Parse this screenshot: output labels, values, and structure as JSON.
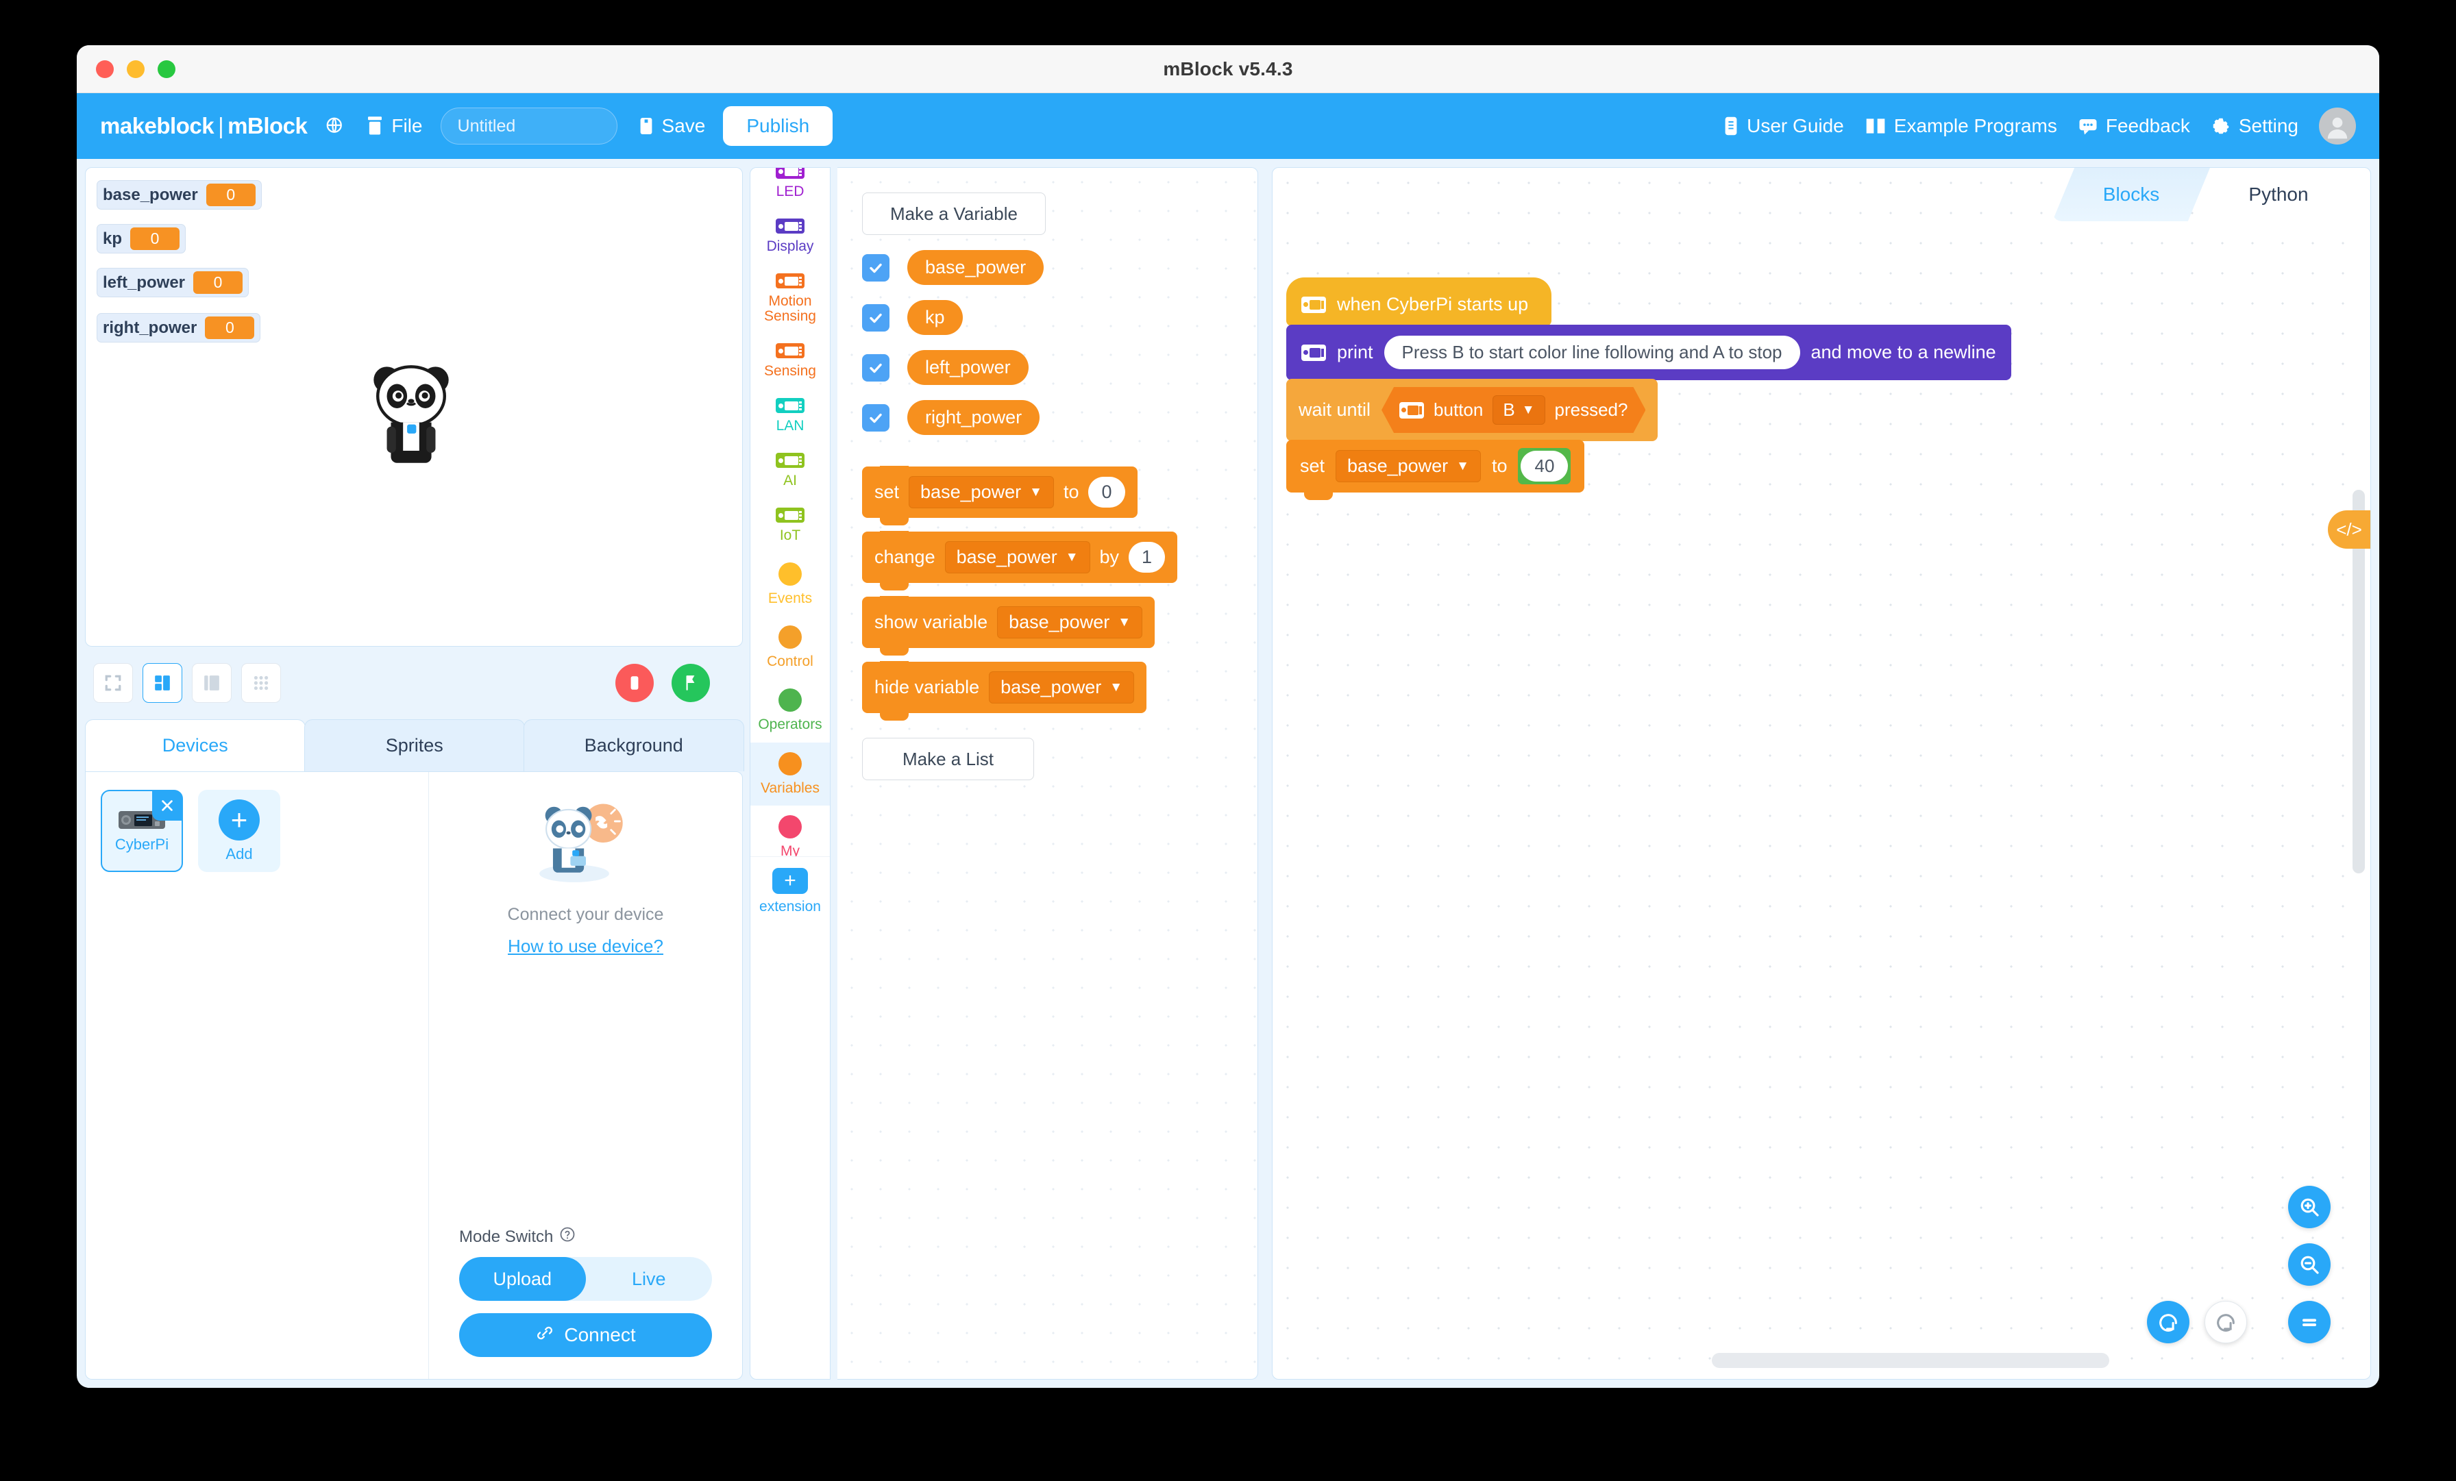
{
  "window": {
    "title": "mBlock v5.4.3",
    "traffic_lights": [
      "close",
      "minimize",
      "maximize"
    ]
  },
  "toolbar": {
    "logo_left": "makeblock",
    "logo_sep": "|",
    "logo_right": "mBlock",
    "globe_icon": "globe-icon",
    "file_icon": "file-icon",
    "file_label": "File",
    "project_name": "Untitled",
    "project_placeholder": "Untitled",
    "save_icon": "save-icon",
    "save_label": "Save",
    "publish_label": "Publish",
    "right_items": [
      {
        "icon": "user-guide-icon",
        "label": "User Guide"
      },
      {
        "icon": "book-icon",
        "label": "Example Programs"
      },
      {
        "icon": "feedback-icon",
        "label": "Feedback"
      },
      {
        "icon": "gear-icon",
        "label": "Setting"
      }
    ],
    "avatar": "avatar",
    "accent": "#29a8f8"
  },
  "stage": {
    "monitors": [
      {
        "name": "base_power",
        "value": "0"
      },
      {
        "name": "kp",
        "value": "0"
      },
      {
        "name": "left_power",
        "value": "0"
      },
      {
        "name": "right_power",
        "value": "0"
      }
    ],
    "sprite": "panda-sprite",
    "layout_buttons": [
      "fullscreen-layout",
      "small-stage-layout",
      "large-stage-layout",
      "sprite-grid-layout"
    ],
    "active_layout": 1,
    "stop_button": "stop-button",
    "start_button": "green-flag-button",
    "monitor_value_color": "#f79223"
  },
  "panel": {
    "tabs": [
      {
        "label": "Devices",
        "active": true
      },
      {
        "label": "Sprites",
        "active": false
      },
      {
        "label": "Background",
        "active": false
      }
    ],
    "devices": [
      {
        "label": "CyberPi",
        "selected": true,
        "remove": "x"
      },
      {
        "label": "Add",
        "selected": false
      }
    ],
    "connect_illustration": "panda-connect-illustration",
    "connect_text": "Connect your device",
    "connect_link": "How to use device?",
    "mode_label": "Mode Switch",
    "mode_help_icon": "help-circle-icon",
    "mode_options": [
      {
        "label": "Upload",
        "on": true
      },
      {
        "label": "Live",
        "on": false
      }
    ],
    "connect_icon": "link-icon",
    "connect_button": "Connect"
  },
  "categories": [
    {
      "label": "LED",
      "icon": "cyberpi-chip-icon",
      "color": "#a020d0",
      "shape": "chip",
      "active": false,
      "clipped": true
    },
    {
      "label": "Display",
      "icon": "cyberpi-chip-icon",
      "color": "#5b3cc4",
      "shape": "chip",
      "active": false
    },
    {
      "label": "Motion Sensing",
      "icon": "cyberpi-chip-icon",
      "color": "#f4711f",
      "shape": "chip",
      "active": false
    },
    {
      "label": "Sensing",
      "icon": "cyberpi-chip-icon",
      "color": "#f4711f",
      "shape": "chip",
      "active": false
    },
    {
      "label": "LAN",
      "icon": "cyberpi-chip-icon",
      "color": "#12cfc0",
      "shape": "chip",
      "active": false
    },
    {
      "label": "AI",
      "icon": "cyberpi-chip-icon",
      "color": "#8fc31f",
      "shape": "chip",
      "active": false
    },
    {
      "label": "IoT",
      "icon": "cyberpi-chip-icon",
      "color": "#8fc31f",
      "shape": "chip",
      "active": false
    },
    {
      "label": "Events",
      "icon": "category-dot-icon",
      "color": "#ffbf2b",
      "shape": "ball",
      "active": false
    },
    {
      "label": "Control",
      "icon": "category-dot-icon",
      "color": "#f4a02a",
      "shape": "ball",
      "active": false
    },
    {
      "label": "Operators",
      "icon": "category-dot-icon",
      "color": "#4eb44e",
      "shape": "ball",
      "active": false
    },
    {
      "label": "Variables",
      "icon": "category-dot-icon",
      "color": "#f7901e",
      "shape": "ball",
      "active": true
    },
    {
      "label": "My",
      "icon": "category-dot-icon",
      "color": "#f3476d",
      "shape": "ball",
      "active": false,
      "clipped": true
    }
  ],
  "extension": {
    "label": "extension",
    "icon": "plus-icon"
  },
  "palette": {
    "make_variable": "Make a Variable",
    "make_list": "Make a List",
    "variables": [
      {
        "name": "base_power",
        "checked": true
      },
      {
        "name": "kp",
        "checked": true
      },
      {
        "name": "left_power",
        "checked": true
      },
      {
        "name": "right_power",
        "checked": true
      }
    ],
    "blocks": [
      {
        "id": "set",
        "pre": "set",
        "dropdown": "base_power",
        "mid": "to",
        "value": "0"
      },
      {
        "id": "change",
        "pre": "change",
        "dropdown": "base_power",
        "mid": "by",
        "value": "1"
      },
      {
        "id": "show",
        "pre": "show variable",
        "dropdown": "base_power"
      },
      {
        "id": "hide",
        "pre": "hide variable",
        "dropdown": "base_power"
      }
    ],
    "block_color": "#f7901e"
  },
  "workspace": {
    "tabs": [
      {
        "label": "Blocks",
        "active": true
      },
      {
        "label": "Python",
        "active": false
      }
    ],
    "code_toggle_icon": "code-brackets-icon",
    "script": {
      "hat": {
        "icon": "cyberpi-chip-icon",
        "label": "when CyberPi starts up",
        "color": "#f5b526"
      },
      "print": {
        "icon": "cyberpi-chip-icon",
        "pre": "print",
        "value": "Press B to start color line following and A to stop",
        "post": "and move to a newline",
        "color": "#5b3cc4"
      },
      "wait_until": {
        "pre": "wait until",
        "color": "#f5a73c",
        "condition": {
          "icon": "cyberpi-chip-icon",
          "pre": "button",
          "dropdown": "B",
          "post": "pressed?",
          "color": "#f4801a"
        }
      },
      "set": {
        "pre": "set",
        "dropdown": "base_power",
        "mid": "to",
        "value": "40",
        "color": "#f7901e",
        "highlight": "#53b849"
      }
    },
    "fabs": [
      {
        "icon": "zoom-in-icon",
        "name": "zoom-in"
      },
      {
        "icon": "zoom-out-icon",
        "name": "zoom-out"
      },
      {
        "icon": "zoom-reset-icon",
        "name": "zoom-reset"
      }
    ],
    "undo": {
      "icon": "undo-icon",
      "enabled": true
    },
    "redo": {
      "icon": "redo-icon",
      "enabled": false
    }
  }
}
